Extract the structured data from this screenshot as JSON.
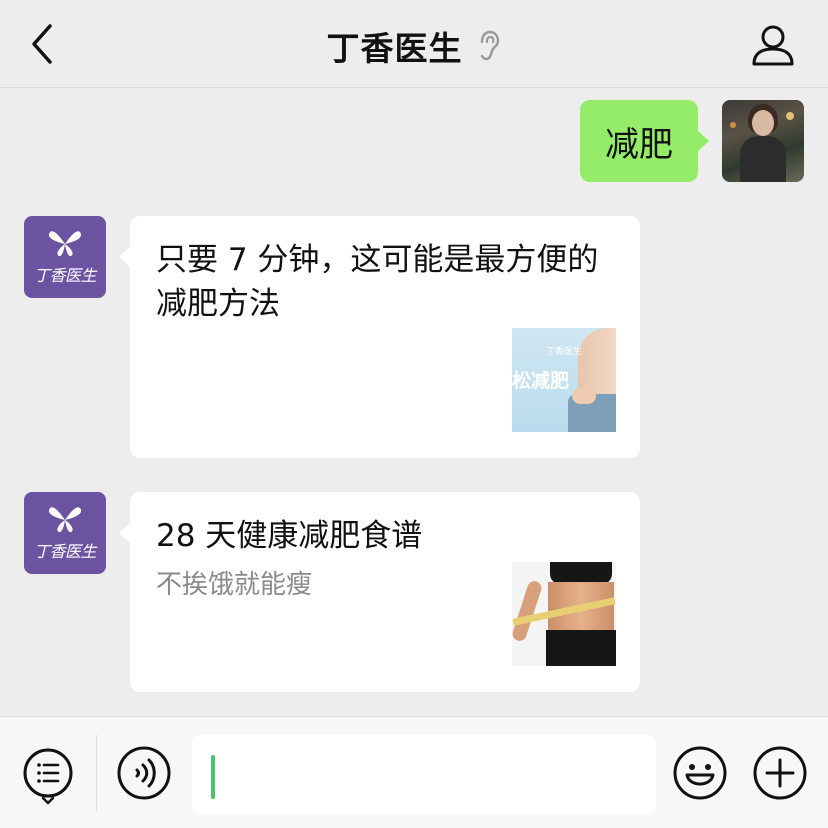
{
  "header": {
    "title": "丁香医生",
    "back_icon": "chevron-left-icon",
    "ear_icon": "ear-icon",
    "profile_icon": "person-icon"
  },
  "messages": [
    {
      "from": "me",
      "text": "减肥"
    },
    {
      "from": "bot",
      "avatar_text": "丁香医生",
      "card": {
        "title": "只要 7 分钟，这可能是最方便的减肥方法",
        "thumb_logo": "丁香医生",
        "thumb_text": "松减肥"
      }
    },
    {
      "from": "bot",
      "avatar_text": "丁香医生",
      "card": {
        "title": "28 天健康减肥食谱",
        "desc": "不挨饿就能瘦"
      }
    }
  ],
  "input_bar": {
    "menu_icon": "list-menu-icon",
    "voice_icon": "voice-icon",
    "emoji_icon": "smiley-icon",
    "plus_icon": "plus-icon",
    "input_value": ""
  },
  "colors": {
    "background": "#ededed",
    "my_bubble": "#95ec69",
    "brand_purple": "#6c53a2",
    "caret": "#4cc26a"
  }
}
